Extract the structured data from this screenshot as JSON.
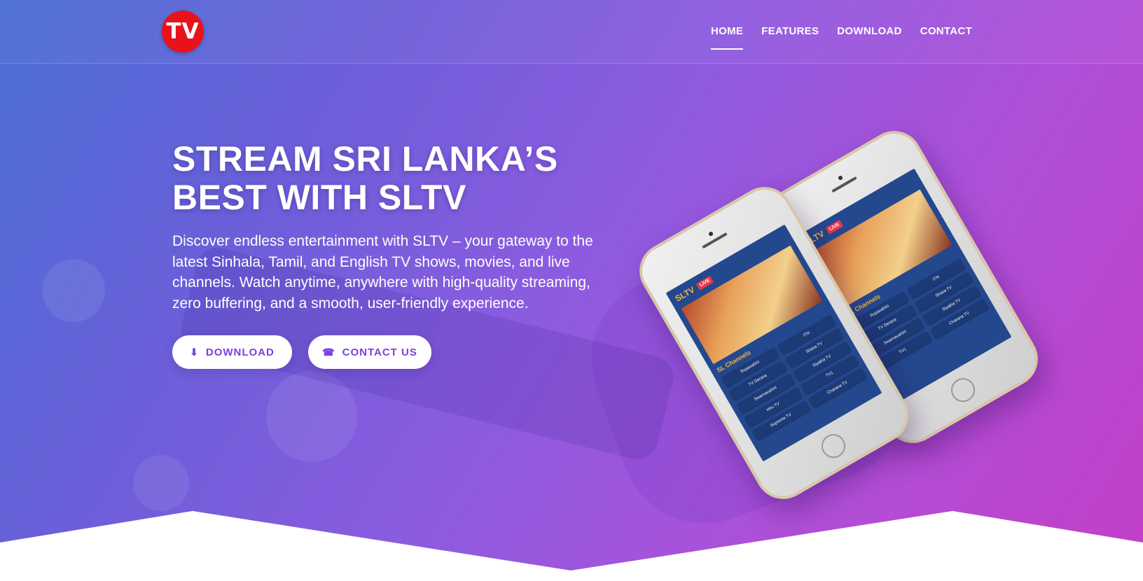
{
  "brand": {
    "logo_text": "TV",
    "logo_color": "#e8121a"
  },
  "nav": {
    "items": [
      {
        "label": "HOME",
        "active": true
      },
      {
        "label": "FEATURES",
        "active": false
      },
      {
        "label": "DOWNLOAD",
        "active": false
      },
      {
        "label": "CONTACT",
        "active": false
      }
    ]
  },
  "hero": {
    "headline_line1": "STREAM SRI LANKA’S",
    "headline_line2": "BEST WITH SLTV",
    "lead": "Discover endless entertainment with SLTV – your gateway to the latest Sinhala, Tamil, and English TV shows, movies, and live channels. Watch anytime, anywhere with high-quality streaming, zero buffering, and a smooth, user-friendly experience.",
    "buttons": {
      "download_label": "DOWNLOAD",
      "download_icon": "download-icon",
      "contact_label": "CONTACT US",
      "contact_icon": "phone-icon"
    }
  },
  "phone_app": {
    "app_title": "SLTV",
    "live_badge": "LIVE",
    "section_title": "SL Channels",
    "channels_front": [
      "Rupavahini",
      "ITN",
      "TV Derana",
      "Sirasa TV",
      "Swarnavahini",
      "Siyatha TV",
      "Hiru TV",
      "TV1",
      "Supreme TV",
      "Charana TV"
    ],
    "channels_back": [
      "Rupavahini",
      "ITN",
      "TV Derana",
      "Sirasa TV",
      "Swarnavahini",
      "Siyatha TV",
      "TV1",
      "Charana TV"
    ]
  },
  "colors": {
    "gradient_start": "#4a6fd6",
    "gradient_end": "#c23fc7",
    "button_text": "#7d3fe0"
  }
}
